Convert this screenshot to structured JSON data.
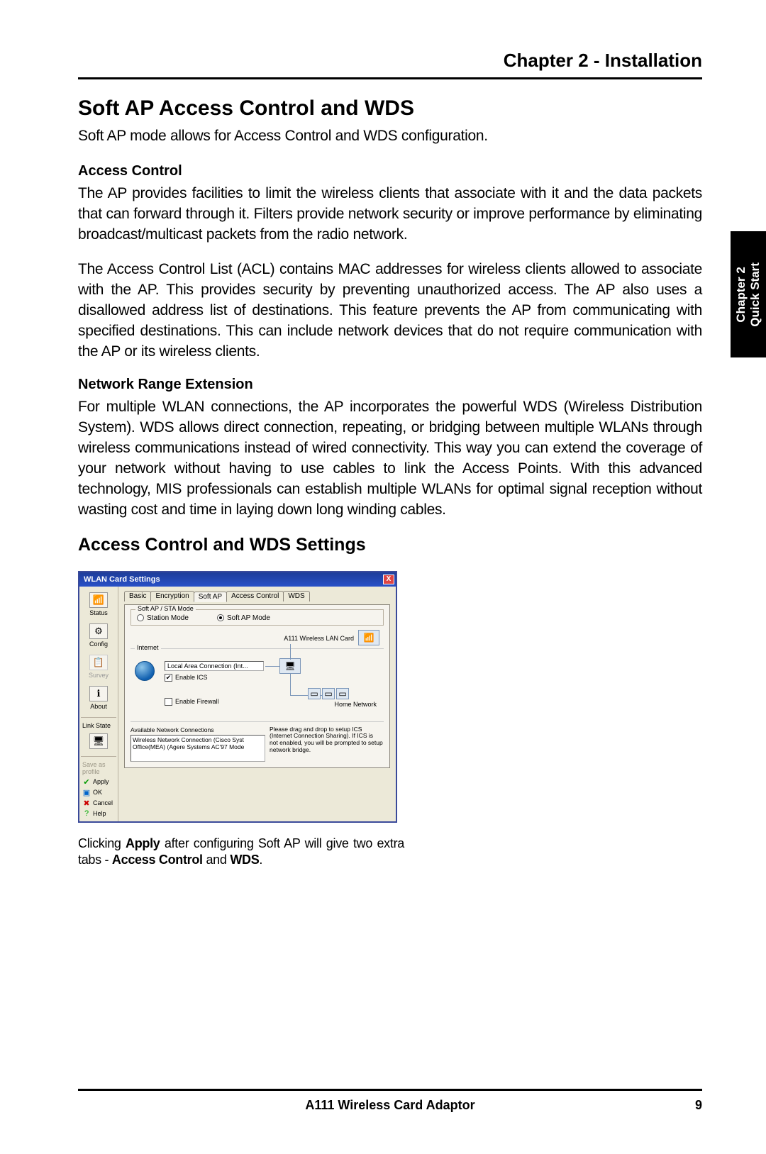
{
  "header": {
    "chapter_title": "Chapter 2 - Installation"
  },
  "side_tab": {
    "line1": "Chapter 2",
    "line2": "Quick Start"
  },
  "section": {
    "title": "Soft AP Access Control and WDS",
    "intro": "Soft AP mode allows for Access Control and WDS configuration.",
    "access_control_head": "Access Control",
    "access_control_p1": "The AP provides facilities to limit the wireless clients that associate with it and the data packets that can forward through it. Filters provide network security or improve performance by eliminating broadcast/multicast packets from the radio network.",
    "access_control_p2": "The Access Control List (ACL) contains MAC addresses for wireless clients allowed to associate with the AP. This provides security by preventing unauthorized access. The AP also uses a disallowed address list of destinations. This feature prevents the AP from communicating with specified destinations. This can include network devices that do not require communication with the AP or its wireless clients.",
    "nre_head": "Network Range Extension",
    "nre_p": "For multiple WLAN connections, the AP incorporates the powerful WDS (Wireless Distribution System). WDS allows direct connection, repeating, or bridging between multiple WLANs through wireless communications instead of wired connectivity. This way you can extend the coverage of your network without having to use cables to link the Access Points. With this advanced technology, MIS professionals can establish multiple WLANs for optimal signal reception without wasting cost and time in laying down long winding cables.",
    "settings_title": "Access Control and WDS Settings"
  },
  "dialog": {
    "title": "WLAN Card Settings",
    "close": "X",
    "sidebar": {
      "status": "Status",
      "config": "Config",
      "survey": "Survey",
      "about": "About",
      "link_state": "Link State",
      "save_profile": "Save as profile",
      "apply": "Apply",
      "ok": "OK",
      "cancel": "Cancel",
      "help": "Help"
    },
    "tabs": [
      "Basic",
      "Encryption",
      "Soft AP",
      "Access Control",
      "WDS"
    ],
    "active_tab": "Soft AP",
    "mode_group": "Soft AP / STA Mode",
    "radio_station": "Station Mode",
    "radio_softap": "Soft AP Mode",
    "internet_group": "Internet",
    "lan_card_label": "A111 Wireless LAN Card",
    "lac_field": "Local Area Connection (Int...",
    "enable_ics": "Enable ICS",
    "enable_firewall": "Enable Firewall",
    "home_net": "Home Network",
    "avail_label": "Available Network Connections",
    "avail_items": [
      "Wireless Network Connection (Cisco Syst",
      "Office(MEA) (Agere Systems AC'97 Mode"
    ],
    "hint": "Please drag and drop to setup ICS (Internet Connection Sharing). If ICS is not enabled, you will be prompted to setup network bridge."
  },
  "caption": {
    "pre": "Clicking ",
    "b1": "Apply",
    "mid": " after configuring Soft AP will give two extra tabs - ",
    "b2": "Access Control",
    "and": " and ",
    "b3": "WDS",
    "end": "."
  },
  "footer": {
    "product": "A111 Wireless Card Adaptor",
    "page": "9"
  }
}
